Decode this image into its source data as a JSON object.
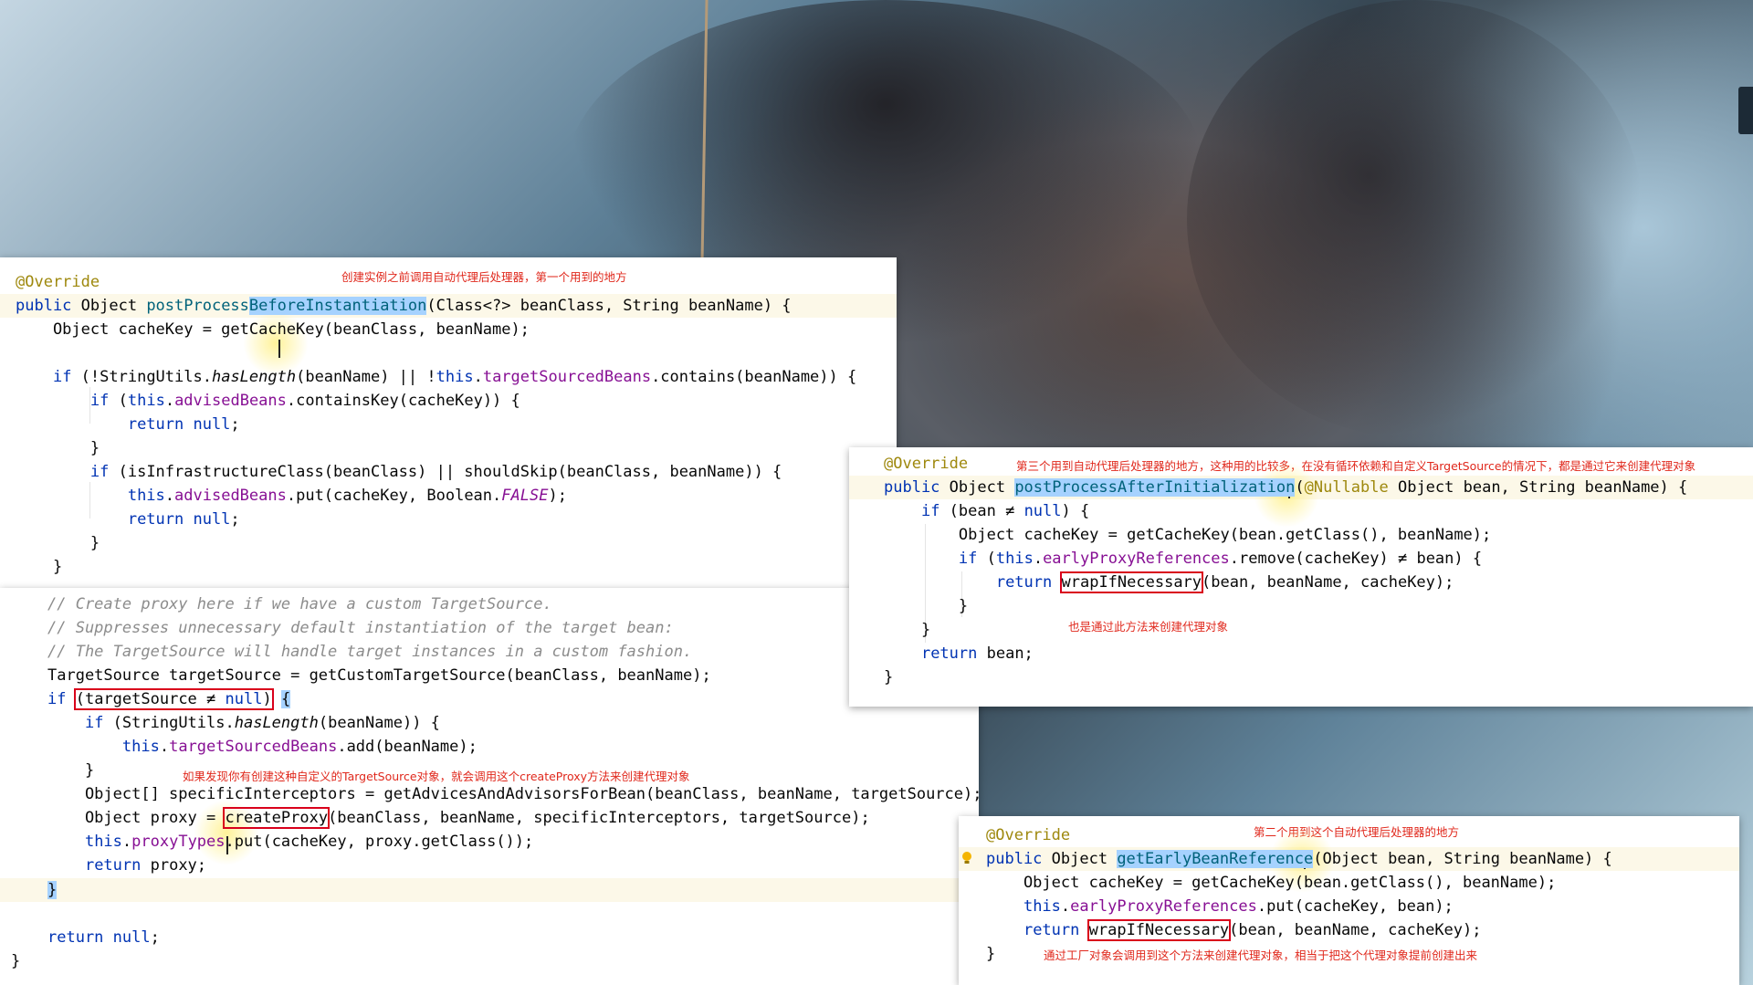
{
  "panel1": {
    "annotation": "创建实例之前调用自动代理后处理器，第一个用到的地方",
    "lines": [
      "@Override",
      "public Object postProcessBeforeInstantiation(Class<?> beanClass, String beanName) {",
      "    Object cacheKey = getCacheKey(beanClass, beanName);",
      "",
      "    if (!StringUtils.hasLength(beanName) || !this.targetSourcedBeans.contains(beanName)) {",
      "        if (this.advisedBeans.containsKey(cacheKey)) {",
      "            return null;",
      "        }",
      "        if (isInfrastructureClass(beanClass) || shouldSkip(beanClass, beanName)) {",
      "            this.advisedBeans.put(cacheKey, Boolean.FALSE);",
      "            return null;",
      "        }",
      "    }"
    ]
  },
  "panel2": {
    "annotation_top": "如果发现你有创建这种自定义的TargetSource对象，就会调用这个createProxy方法来创建代理对象",
    "lines": [
      "// Create proxy here if we have a custom TargetSource.",
      "// Suppresses unnecessary default instantiation of the target bean:",
      "// The TargetSource will handle target instances in a custom fashion.",
      "TargetSource targetSource = getCustomTargetSource(beanClass, beanName);",
      "if (targetSource ≠ null) {",
      "    if (StringUtils.hasLength(beanName)) {",
      "        this.targetSourcedBeans.add(beanName);",
      "    }",
      "    Object[] specificInterceptors = getAdvicesAndAdvisorsForBean(beanClass, beanName, targetSource);",
      "    Object proxy = createProxy(beanClass, beanName, specificInterceptors, targetSource);",
      "    this.proxyTypes.put(cacheKey, proxy.getClass());",
      "    return proxy;",
      "}",
      "",
      "return null;",
      "}"
    ]
  },
  "panel3": {
    "annotation_top": "第三个用到自动代理后处理器的地方，这种用的比较多，在没有循环依赖和自定义TargetSource的情况下，都是通过它来创建代理对象",
    "annotation_bottom": "也是通过此方法来创建代理对象",
    "lines": [
      "@Override",
      "public Object postProcessAfterInitialization(@Nullable Object bean, String beanName) {",
      "    if (bean ≠ null) {",
      "        Object cacheKey = getCacheKey(bean.getClass(), beanName);",
      "        if (this.earlyProxyReferences.remove(cacheKey) ≠ bean) {",
      "            return wrapIfNecessary(bean, beanName, cacheKey);",
      "        }",
      "    }",
      "    return bean;",
      "}"
    ]
  },
  "panel4": {
    "annotation_top": "第二个用到这个自动代理后处理器的地方",
    "annotation_bottom": "通过工厂对象会调用到这个方法来创建代理对象，相当于把这个代理对象提前创建出来",
    "lines": [
      "@Override",
      "public Object getEarlyBeanReference(Object bean, String beanName) {",
      "    Object cacheKey = getCacheKey(bean.getClass(), beanName);",
      "    this.earlyProxyReferences.put(cacheKey, bean);",
      "    return wrapIfNecessary(bean, beanName, cacheKey);",
      "}"
    ]
  },
  "colors": {
    "keyword": "#0033b3",
    "annotation": "#9e880d",
    "field": "#871094",
    "comment": "#8c8c8c",
    "note": "#e0281c",
    "selection": "#a6d2ff",
    "box": "#d9001b"
  }
}
